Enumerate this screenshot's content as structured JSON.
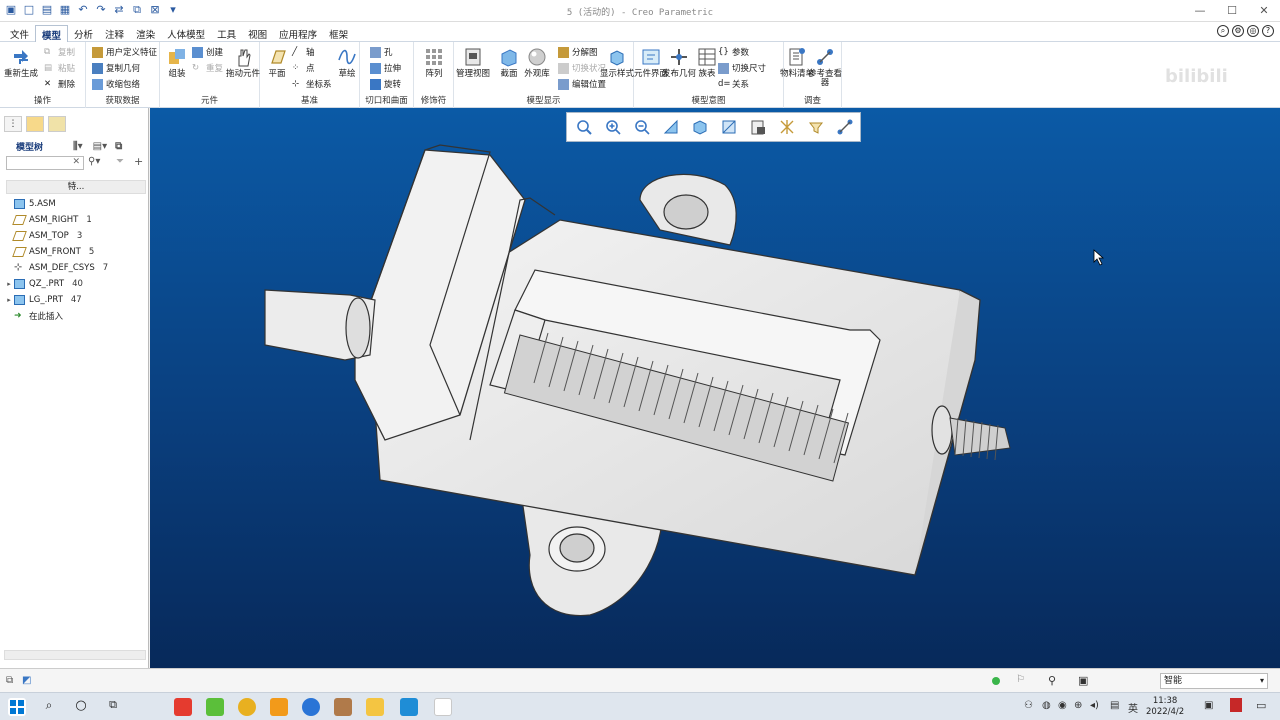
{
  "window": {
    "title": "5 (活动的) - Creo Parametric"
  },
  "menu": {
    "tabs": [
      "文件",
      "模型",
      "分析",
      "注释",
      "渲染",
      "人体模型",
      "工具",
      "视图",
      "应用程序",
      "框架"
    ],
    "active": "模型"
  },
  "ribbon": {
    "groups": [
      {
        "label": "操作",
        "items": [
          "重新生成",
          "复制",
          "粘贴",
          "删除"
        ]
      },
      {
        "label": "获取数据",
        "items": [
          "用户定义特征",
          "复制几何",
          "收缩包络"
        ]
      },
      {
        "label": "元件",
        "items": [
          "组装",
          "创建",
          "重复",
          "拖动元件"
        ]
      },
      {
        "label": "基准",
        "items": [
          "平面",
          "轴",
          "点",
          "坐标系",
          "草绘"
        ]
      },
      {
        "label": "切口和曲面",
        "items": [
          "孔",
          "拉伸",
          "旋转"
        ]
      },
      {
        "label": "修饰符",
        "items": [
          "阵列"
        ]
      },
      {
        "label": "模型显示",
        "items": [
          "管理视图",
          "截面",
          "外观库",
          "分解图",
          "切换状况",
          "编辑位置",
          "显示样式"
        ]
      },
      {
        "label": "模型意图",
        "items": [
          "元件界面",
          "发布几何",
          "族表",
          "参数",
          "切换尺寸",
          "关系"
        ]
      },
      {
        "label": "调查",
        "items": [
          "物料清单",
          "参考查看器"
        ]
      }
    ]
  },
  "left_panel": {
    "tab_icons": [
      "tree-tab-icon",
      "folder-tab-icon",
      "favorites-tab-icon"
    ],
    "title": "模型树",
    "column_header": "特...",
    "tree": [
      {
        "label": "5.ASM",
        "num": "",
        "icon": "assembly-icon",
        "expand": false
      },
      {
        "label": "ASM_RIGHT",
        "num": "1",
        "icon": "plane-icon",
        "expand": false
      },
      {
        "label": "ASM_TOP",
        "num": "3",
        "icon": "plane-icon",
        "expand": false
      },
      {
        "label": "ASM_FRONT",
        "num": "5",
        "icon": "plane-icon",
        "expand": false
      },
      {
        "label": "ASM_DEF_CSYS",
        "num": "7",
        "icon": "csys-icon",
        "expand": false
      },
      {
        "label": "QZ_.PRT",
        "num": "40",
        "icon": "part-icon",
        "expand": true
      },
      {
        "label": "LG_.PRT",
        "num": "47",
        "icon": "part-icon",
        "expand": true
      },
      {
        "label": "在此插入",
        "num": "",
        "icon": "insert-icon",
        "expand": false
      }
    ]
  },
  "status_bar": {
    "selector": "智能"
  },
  "taskbar": {
    "time": "11:38",
    "date": "2022/4/2"
  },
  "watermark": "bilibili",
  "colors": {
    "accent": "#1a3d7c",
    "viewport_top": "#0b5aa6",
    "viewport_bottom": "#07295a"
  }
}
